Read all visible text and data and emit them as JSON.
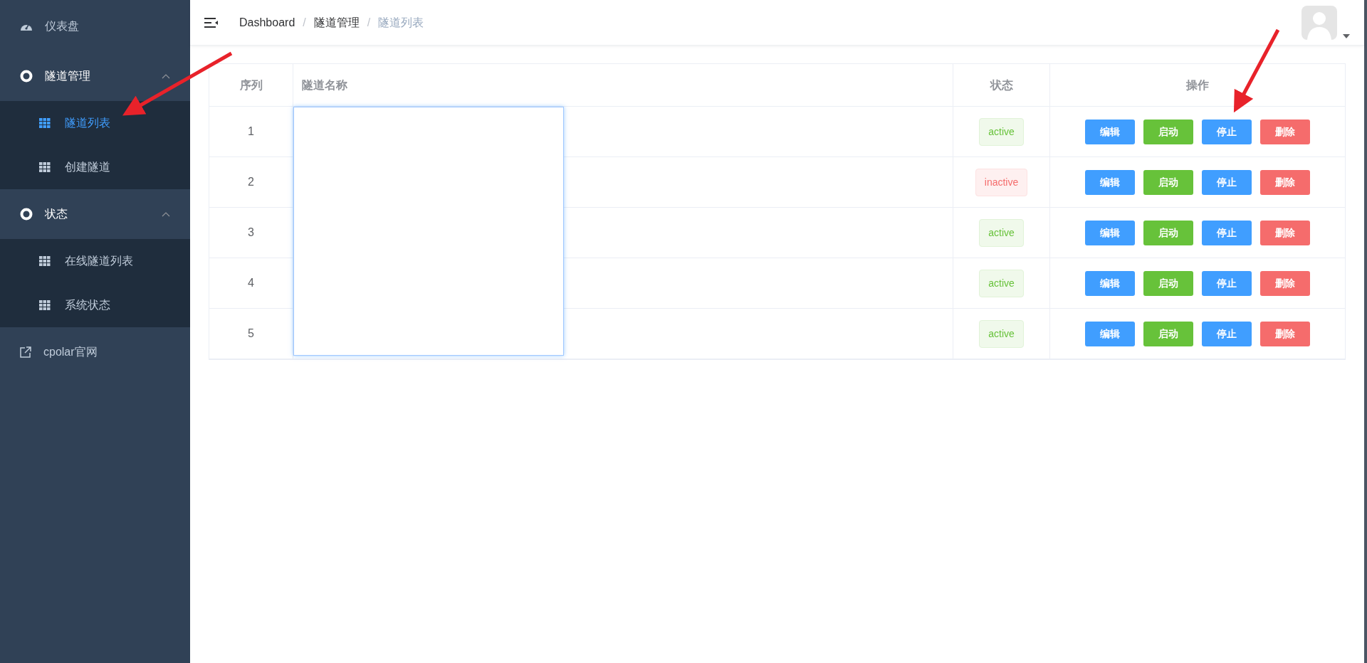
{
  "sidebar": {
    "items": [
      {
        "kind": "link",
        "label": "仪表盘",
        "selected": false
      },
      {
        "kind": "group",
        "label": "隧道管理",
        "expanded": true,
        "children": [
          {
            "label": "隧道列表",
            "selected": true
          },
          {
            "label": "创建隧道",
            "selected": false
          }
        ]
      },
      {
        "kind": "group",
        "label": "状态",
        "expanded": true,
        "children": [
          {
            "label": "在线隧道列表",
            "selected": false
          },
          {
            "label": "系统状态",
            "selected": false
          }
        ]
      },
      {
        "kind": "external",
        "label": "cpolar官网",
        "selected": false
      }
    ]
  },
  "breadcrumb": [
    "Dashboard",
    "隧道管理",
    "隧道列表"
  ],
  "breadcrumb_separators": [
    "/",
    "/"
  ],
  "table": {
    "columns": [
      "序列",
      "隧道名称",
      "状态",
      "操作"
    ],
    "rows": [
      {
        "index": "1",
        "status": {
          "text": "active",
          "kind": "success"
        },
        "actions": [
          {
            "label": "编辑",
            "kind": "primary"
          },
          {
            "label": "启动",
            "kind": "success"
          },
          {
            "label": "停止",
            "kind": "primary"
          },
          {
            "label": "删除",
            "kind": "danger"
          }
        ]
      },
      {
        "index": "2",
        "status": {
          "text": "inactive",
          "kind": "danger"
        },
        "actions": [
          {
            "label": "编辑",
            "kind": "primary"
          },
          {
            "label": "启动",
            "kind": "success"
          },
          {
            "label": "停止",
            "kind": "primary"
          },
          {
            "label": "删除",
            "kind": "danger"
          }
        ]
      },
      {
        "index": "3",
        "status": {
          "text": "active",
          "kind": "success"
        },
        "actions": [
          {
            "label": "编辑",
            "kind": "primary"
          },
          {
            "label": "启动",
            "kind": "success"
          },
          {
            "label": "停止",
            "kind": "primary"
          },
          {
            "label": "删除",
            "kind": "danger"
          }
        ]
      },
      {
        "index": "4",
        "status": {
          "text": "active",
          "kind": "success"
        },
        "actions": [
          {
            "label": "编辑",
            "kind": "primary"
          },
          {
            "label": "启动",
            "kind": "success"
          },
          {
            "label": "停止",
            "kind": "primary"
          },
          {
            "label": "删除",
            "kind": "danger"
          }
        ]
      },
      {
        "index": "5",
        "status": {
          "text": "active",
          "kind": "success"
        },
        "actions": [
          {
            "label": "编辑",
            "kind": "primary"
          },
          {
            "label": "启动",
            "kind": "success"
          },
          {
            "label": "停止",
            "kind": "primary"
          },
          {
            "label": "删除",
            "kind": "danger"
          }
        ]
      }
    ]
  }
}
